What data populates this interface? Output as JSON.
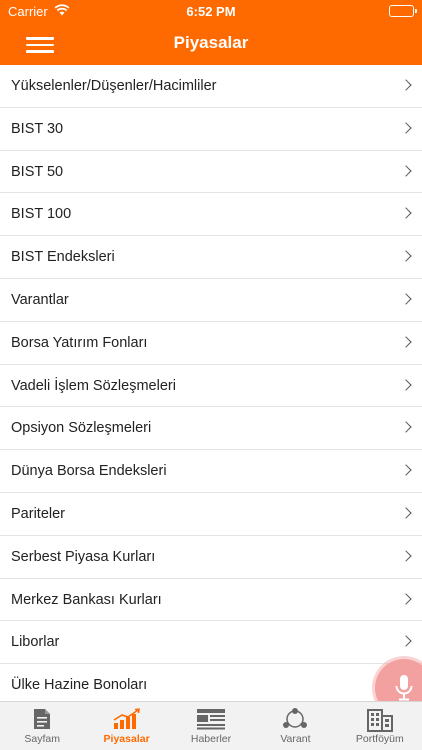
{
  "status_bar": {
    "carrier": "Carrier",
    "time": "6:52 PM"
  },
  "header": {
    "title": "Piyasalar",
    "menu_icon": "hamburger-menu-icon"
  },
  "list": {
    "items": [
      {
        "label": "Yükselenler/Düşenler/Hacimliler"
      },
      {
        "label": "BIST 30"
      },
      {
        "label": "BIST 50"
      },
      {
        "label": "BIST 100"
      },
      {
        "label": "BIST Endeksleri"
      },
      {
        "label": "Varantlar"
      },
      {
        "label": "Borsa Yatırım Fonları"
      },
      {
        "label": "Vadeli İşlem Sözleşmeleri"
      },
      {
        "label": "Opsiyon Sözleşmeleri"
      },
      {
        "label": "Dünya Borsa Endeksleri"
      },
      {
        "label": "Pariteler"
      },
      {
        "label": "Serbest Piyasa Kurları"
      },
      {
        "label": "Merkez Bankası Kurları"
      },
      {
        "label": "Liborlar"
      },
      {
        "label": "Ülke Hazine Bonoları"
      }
    ]
  },
  "tabbar": {
    "tabs": [
      {
        "label": "Sayfam",
        "icon": "document-icon",
        "active": false
      },
      {
        "label": "Piyasalar",
        "icon": "chart-bars-icon",
        "active": true
      },
      {
        "label": "Haberler",
        "icon": "newspaper-icon",
        "active": false
      },
      {
        "label": "Varant",
        "icon": "network-icon",
        "active": false
      },
      {
        "label": "Portföyüm",
        "icon": "building-icon",
        "active": false
      }
    ]
  },
  "colors": {
    "accent": "#ff6a00",
    "mic_bg": "#f3a0a0",
    "tab_inactive": "#666666"
  }
}
